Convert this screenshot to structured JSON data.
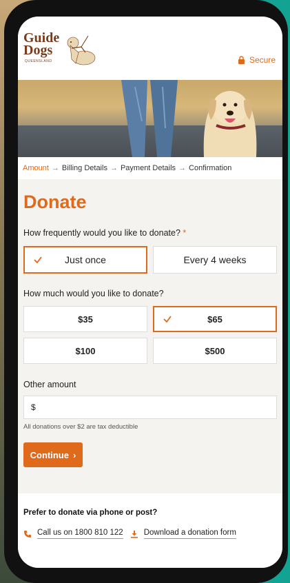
{
  "brand": {
    "logo_line1": "Guide",
    "logo_line2": "Dogs",
    "logo_sub": "QUEENSLAND",
    "secure_label": "Secure",
    "accent_color": "#e06a1c"
  },
  "breadcrumb": {
    "steps": [
      "Amount",
      "Billing Details",
      "Payment Details",
      "Confirmation"
    ],
    "active_index": 0
  },
  "form": {
    "title": "Donate",
    "frequency_question": "How frequently would you like to donate?",
    "required_mark": "*",
    "frequency_options": [
      {
        "label": "Just once",
        "selected": true
      },
      {
        "label": "Every 4 weeks",
        "selected": false
      }
    ],
    "amount_question": "How much would you like to donate?",
    "amount_options": [
      {
        "label": "$35",
        "selected": false
      },
      {
        "label": "$65",
        "selected": true
      },
      {
        "label": "$100",
        "selected": false
      },
      {
        "label": "$500",
        "selected": false
      }
    ],
    "other_amount_label": "Other amount",
    "other_amount_prefix": "$",
    "tax_note": "All donations over $2 are tax deductible",
    "continue_label": "Continue",
    "continue_arrow": "›"
  },
  "footer": {
    "title": "Prefer to donate via phone or post?",
    "phone_link": "Call us on 1800 810 122",
    "download_link": "Download a donation form"
  },
  "icons": {
    "lock": "lock-icon",
    "check": "check-icon",
    "phone": "phone-icon",
    "download": "download-icon"
  }
}
